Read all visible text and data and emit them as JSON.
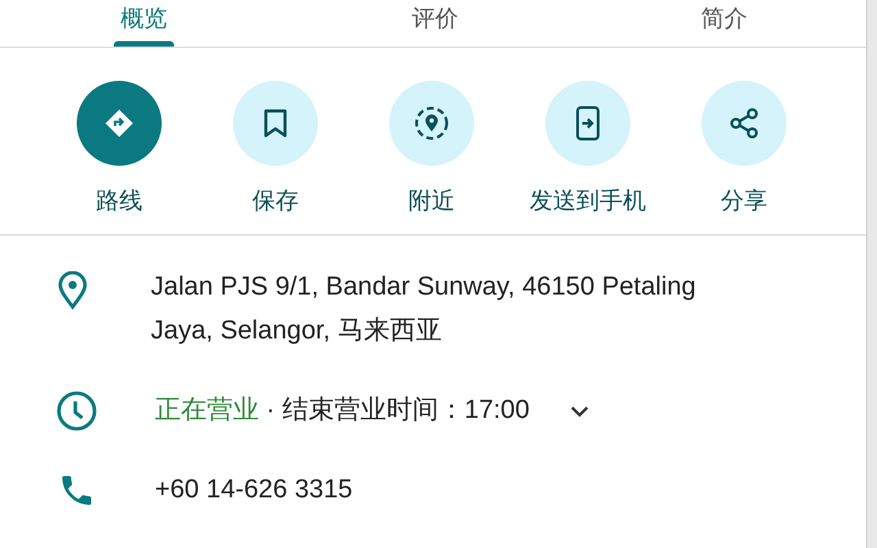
{
  "tabs": [
    {
      "label": "概览",
      "selected": true
    },
    {
      "label": "评价",
      "selected": false
    },
    {
      "label": "简介",
      "selected": false
    }
  ],
  "actions": [
    {
      "kind": "directions",
      "label": "路线",
      "highlighted": true
    },
    {
      "kind": "save",
      "label": "保存",
      "highlighted": false
    },
    {
      "kind": "nearby",
      "label": "附近",
      "highlighted": false
    },
    {
      "kind": "send",
      "label": "发送到手机",
      "highlighted": false
    },
    {
      "kind": "share",
      "label": "分享",
      "highlighted": false
    }
  ],
  "details": [
    {
      "kind": "address",
      "text": "Jalan PJS 9/1, Bandar Sunway, 46150 Petaling Jaya, Selangor, 马来西亚"
    },
    {
      "kind": "hours",
      "status": "正在营业",
      "text": "· 结束营业时间：17:00",
      "expandable": true
    },
    {
      "kind": "phone",
      "text": "+60 14-626 3315"
    }
  ]
}
